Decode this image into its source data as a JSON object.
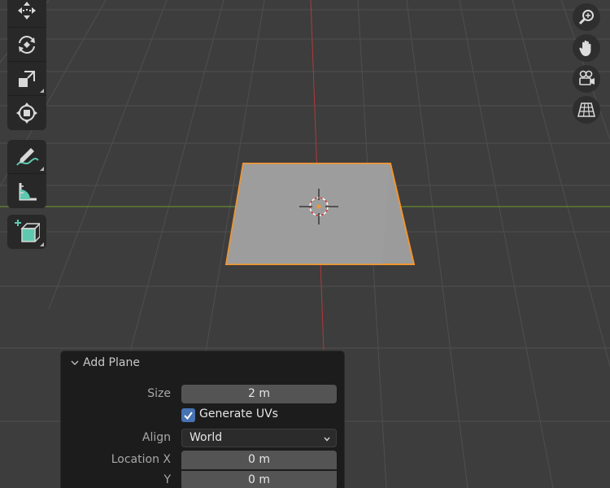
{
  "viewport": {
    "background_color": "#3d3d3d",
    "grid_color": "#4f4f4f",
    "x_axis_color": "#b3383b",
    "y_axis_color": "#6f9a2e",
    "selection_outline_color": "#f2952e",
    "plane_fill_color": "#9b9b9b"
  },
  "toolbar": {
    "tools": [
      {
        "name": "move-tool",
        "icon": "move-arrows-icon"
      },
      {
        "name": "rotate-tool",
        "icon": "rotate-icon"
      },
      {
        "name": "scale-tool",
        "icon": "scale-icon"
      },
      {
        "name": "transform-tool",
        "icon": "transform-icon"
      },
      {
        "name": "annotate-tool",
        "icon": "pencil-icon"
      },
      {
        "name": "measure-tool",
        "icon": "ruler-icon"
      },
      {
        "name": "add-cube-tool",
        "icon": "add-cube-icon"
      }
    ]
  },
  "navigation": {
    "buttons": [
      {
        "name": "zoom-button",
        "icon": "magnifier-icon"
      },
      {
        "name": "pan-button",
        "icon": "hand-icon"
      },
      {
        "name": "camera-view-button",
        "icon": "camera-icon"
      },
      {
        "name": "perspective-toggle-button",
        "icon": "grid-icon"
      }
    ]
  },
  "operator_panel": {
    "title": "Add Plane",
    "size_label": "Size",
    "size_value": "2 m",
    "generate_uvs_label": "Generate UVs",
    "generate_uvs_checked": true,
    "align_label": "Align",
    "align_value": "World",
    "location_x_label": "Location X",
    "location_x_value": "0 m",
    "location_y_label": "Y",
    "location_y_value": "0 m"
  }
}
